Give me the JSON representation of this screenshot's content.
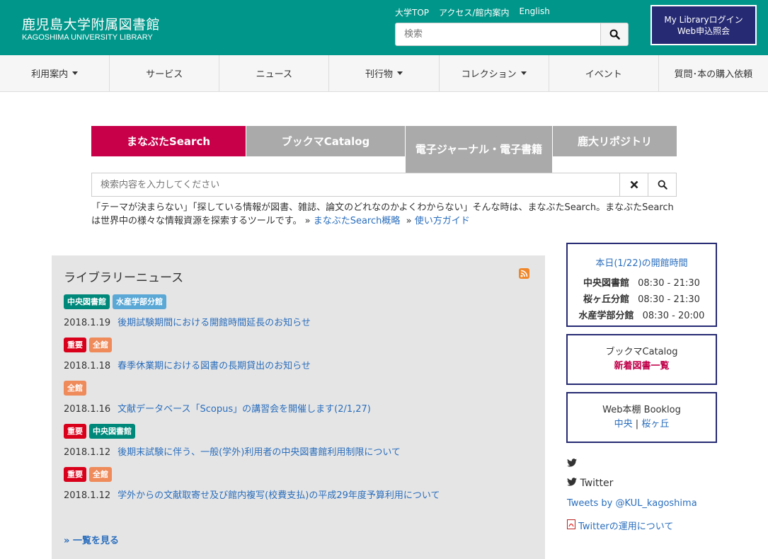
{
  "header": {
    "title": "鹿児島大学附属図書館",
    "subtitle": "KAGOSHIMA UNIVERSITY LIBRARY",
    "links": [
      "大学TOP",
      "アクセス/館内案内",
      "English"
    ],
    "search_placeholder": "検索",
    "mylib_line1": "My Libraryログイン",
    "mylib_line2": "Web申込照会"
  },
  "nav": [
    {
      "label": "利用案内",
      "dropdown": true
    },
    {
      "label": "サービス",
      "dropdown": false
    },
    {
      "label": "ニュース",
      "dropdown": false
    },
    {
      "label": "刊行物",
      "dropdown": true
    },
    {
      "label": "コレクション",
      "dropdown": true
    },
    {
      "label": "イベント",
      "dropdown": false
    },
    {
      "label": "質問･本の購入依頼",
      "dropdown": false
    }
  ],
  "search": {
    "tabs": [
      "まなぶたSearch",
      "ブックマCatalog",
      "電子ジャーナル・電子書籍",
      "鹿大リポジトリ"
    ],
    "placeholder": "検索内容を入力してください",
    "description": "「テーマが決まらない」「探している情報が図書、雑誌、論文のどれなのかよくわからない」そんな時は、まなぶたSearch。まなぶたSearchは世界中の様々な情報資源を探索するツールです。",
    "link1": "まなぶたSearch概略",
    "link2": "使い方ガイド"
  },
  "news": {
    "title": "ライブラリーニュース",
    "items": [
      {
        "badges": [
          "中央図書館",
          "水産学部分館"
        ],
        "date": "2018.1.19",
        "text": "後期試験期間における開館時間延長のお知らせ"
      },
      {
        "badges": [
          "重要",
          "全館"
        ],
        "date": "2018.1.18",
        "text": "春季休業期における図書の長期貸出のお知らせ"
      },
      {
        "badges": [
          "全館"
        ],
        "date": "2018.1.16",
        "text": "文献データベース「Scopus」の講習会を開催します(2/1,27)"
      },
      {
        "badges": [
          "重要",
          "中央図書館"
        ],
        "date": "2018.1.12",
        "text": "後期末試験に伴う、一般(学外)利用者の中央図書館利用制限について"
      },
      {
        "badges": [
          "重要",
          "全館"
        ],
        "date": "2018.1.12",
        "text": "学外からの文献取寄せ及び館内複写(校費支払)の平成29年度予算利用について"
      }
    ],
    "more": "一覧を見る"
  },
  "hours": {
    "title": "本日(1/22)の開館時間",
    "rows": [
      {
        "name": "中央図書館",
        "time": "08:30 - 21:30"
      },
      {
        "name": "桜ヶ丘分館",
        "time": "08:30 - 21:30"
      },
      {
        "name": "水産学部分館",
        "time": "08:30 - 20:00"
      }
    ]
  },
  "catalog_box": {
    "line1": "ブックマCatalog",
    "line2": "新着図書一覧"
  },
  "booklog_box": {
    "line1": "Web本棚 Booklog",
    "link1": "中央",
    "separator": "|",
    "link2": "桜ヶ丘"
  },
  "twitter": {
    "label": "Twitter",
    "tweets_by": "Tweets by @KUL_kagoshima",
    "policy": "Twitterの運用について"
  },
  "colors": {
    "header_bg": "#00968a",
    "mylib_bg": "#262a73",
    "active_tab": "#c8004a",
    "link": "#2a6ebd"
  }
}
